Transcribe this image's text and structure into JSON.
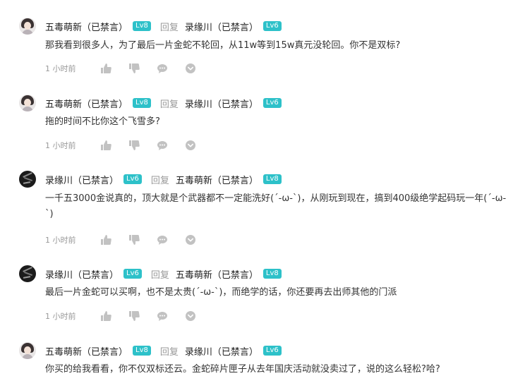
{
  "reply_word": "回复",
  "comments": [
    {
      "author": "五毒萌新（已禁言）",
      "author_level": "Lv8",
      "target": "录缘川（已禁言）",
      "target_level": "Lv6",
      "text": "那我看到很多人，为了最后一片金蛇不轮回，从11w等到15w真元没轮回。你不是双标?",
      "time": "1 小时前",
      "avatar": "girl-avatar"
    },
    {
      "author": "五毒萌新（已禁言）",
      "author_level": "Lv8",
      "target": "录缘川（已禁言）",
      "target_level": "Lv6",
      "text": "拖的时间不比你这个飞雪多?",
      "time": "1 小时前",
      "avatar": "girl-avatar"
    },
    {
      "author": "录缘川（已禁言）",
      "author_level": "Lv6",
      "target": "五毒萌新（已禁言）",
      "target_level": "Lv8",
      "text": "一千五3000金说真的，顶大就是个武器都不一定能洗好(´-ω-`)，从刚玩到现在，搞到400级绝学起码玩一年(´-ω-`)",
      "time": "1 小时前",
      "avatar": "calligraphy-avatar"
    },
    {
      "author": "录缘川（已禁言）",
      "author_level": "Lv6",
      "target": "五毒萌新（已禁言）",
      "target_level": "Lv8",
      "text": "最后一片金蛇可以买啊，也不是太贵(´-ω-`)，而绝学的话，你还要再去出师其他的门派",
      "time": "1 小时前",
      "avatar": "calligraphy-avatar"
    },
    {
      "author": "五毒萌新（已禁言）",
      "author_level": "Lv8",
      "target": "录缘川（已禁言）",
      "target_level": "Lv6",
      "text": "你买的给我看看，你不仅双标还云。金蛇碎片匣子从去年国庆活动就没卖过了，说的这么轻松?哈?",
      "time": "",
      "avatar": "girl-avatar"
    }
  ],
  "colors": {
    "level_badge": "#2dc1c9",
    "muted": "#999999",
    "icon": "#c2c2c2"
  }
}
